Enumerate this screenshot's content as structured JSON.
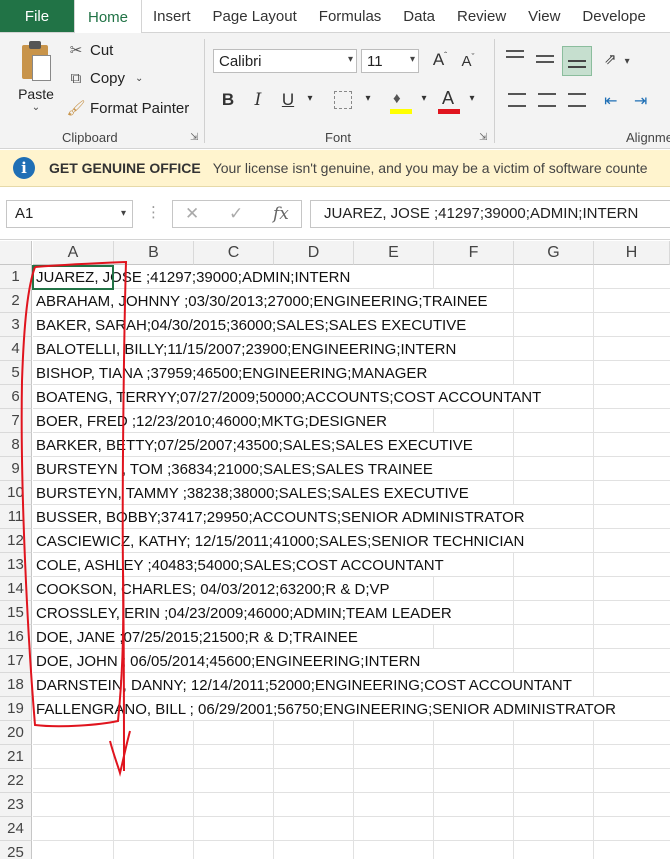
{
  "ribbon_tabs": [
    "File",
    "Home",
    "Insert",
    "Page Layout",
    "Formulas",
    "Data",
    "Review",
    "View",
    "Develope"
  ],
  "clipboard": {
    "paste_label": "Paste",
    "cut_label": "Cut",
    "copy_label": "Copy",
    "format_painter_label": "Format Painter",
    "group_label": "Clipboard"
  },
  "font": {
    "name": "Calibri",
    "size": "11",
    "grow_label": "A",
    "shrink_label": "A",
    "bold_label": "B",
    "italic_label": "I",
    "underline_label": "U",
    "color_label": "A",
    "group_label": "Font"
  },
  "alignment": {
    "group_label": "Alignme"
  },
  "license_bar": {
    "title": "GET GENUINE OFFICE",
    "message": "Your license isn't genuine, and you may be a victim of software counte"
  },
  "formula_bar": {
    "name_box": "A1",
    "fx_label": "fx",
    "formula": "JUAREZ, JOSE ;41297;39000;ADMIN;INTERN"
  },
  "columns": [
    "A",
    "B",
    "C",
    "D",
    "E",
    "F",
    "G",
    "H"
  ],
  "rows": [
    {
      "num": "1",
      "text": "JUAREZ, JOSE ;41297;39000;ADMIN;INTERN"
    },
    {
      "num": "2",
      "text": "ABRAHAM, JOHNNY ;03/30/2013;27000;ENGINEERING;TRAINEE"
    },
    {
      "num": "3",
      "text": "BAKER, SARAH;04/30/2015;36000;SALES;SALES EXECUTIVE"
    },
    {
      "num": "4",
      "text": "BALOTELLI, BILLY;11/15/2007;23900;ENGINEERING;INTERN"
    },
    {
      "num": "5",
      "text": "BISHOP, TIANA ;37959;46500;ENGINEERING;MANAGER"
    },
    {
      "num": "6",
      "text": "BOATENG, TERRYY;07/27/2009;50000;ACCOUNTS;COST ACCOUNTANT"
    },
    {
      "num": "7",
      "text": "BOER, FRED ;12/23/2010;46000;MKTG;DESIGNER"
    },
    {
      "num": "8",
      "text": "BARKER, BETTY;07/25/2007;43500;SALES;SALES EXECUTIVE"
    },
    {
      "num": "9",
      "text": "BURSTEYN , TOM ;36834;21000;SALES;SALES TRAINEE"
    },
    {
      "num": "10",
      "text": "BURSTEYN, TAMMY ;38238;38000;SALES;SALES EXECUTIVE"
    },
    {
      "num": "11",
      "text": "BUSSER, BOBBY;37417;29950;ACCOUNTS;SENIOR ADMINISTRATOR"
    },
    {
      "num": "12",
      "text": "CASCIEWICZ, KATHY; 12/15/2011;41000;SALES;SENIOR TECHNICIAN"
    },
    {
      "num": "13",
      "text": "COLE, ASHLEY ;40483;54000;SALES;COST ACCOUNTANT"
    },
    {
      "num": "14",
      "text": "COOKSON, CHARLES; 04/03/2012;63200;R & D;VP"
    },
    {
      "num": "15",
      "text": "CROSSLEY, ERIN ;04/23/2009;46000;ADMIN;TEAM LEADER"
    },
    {
      "num": "16",
      "text": "DOE, JANE ;07/25/2015;21500;R & D;TRAINEE"
    },
    {
      "num": "17",
      "text": "DOE, JOHN  ; 06/05/2014;45600;ENGINEERING;INTERN"
    },
    {
      "num": "18",
      "text": "DARNSTEIN, DANNY; 12/14/2011;52000;ENGINEERING;COST ACCOUNTANT"
    },
    {
      "num": "19",
      "text": "FALLENGRANO, BILL ; 06/29/2001;56750;ENGINEERING;SENIOR ADMINISTRATOR"
    },
    {
      "num": "20",
      "text": ""
    },
    {
      "num": "21",
      "text": ""
    },
    {
      "num": "22",
      "text": ""
    },
    {
      "num": "23",
      "text": ""
    },
    {
      "num": "24",
      "text": ""
    },
    {
      "num": "25",
      "text": ""
    }
  ],
  "colors": {
    "excel_green": "#217346",
    "annotation_red": "#e0141e",
    "license_bg": "#fff4ce",
    "info_blue": "#1f6fb5"
  }
}
